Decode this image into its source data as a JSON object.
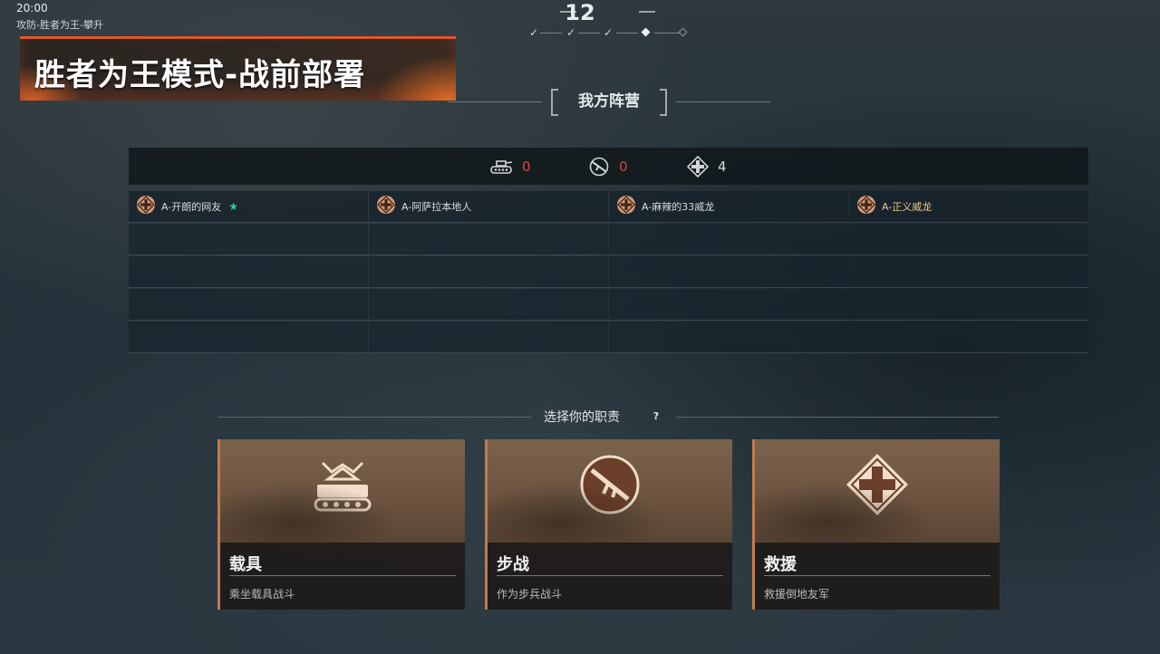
{
  "hud": {
    "clock": "20:00",
    "mode_subtitle": "攻防-胜者为王-攀升",
    "banner_title": "胜者为王模式-战前部署",
    "round_number": "12",
    "accent": "#e0572a"
  },
  "round_progress": {
    "steps": [
      {
        "state": "done",
        "glyph": "✓"
      },
      {
        "state": "done",
        "glyph": "✓"
      },
      {
        "state": "done",
        "glyph": "✓"
      },
      {
        "state": "current"
      },
      {
        "state": "upcoming"
      }
    ]
  },
  "team": {
    "label": "我方阵营",
    "stats": [
      {
        "icon": "tank-icon",
        "value": "0",
        "color": "#d5493b"
      },
      {
        "icon": "rifle-icon",
        "value": "0",
        "color": "#d5493b"
      },
      {
        "icon": "medic-cross-icon",
        "value": "4",
        "color": "#d8dcdc"
      }
    ],
    "players": [
      {
        "name": "A-开朗的网友",
        "role_icon": "medic-cross-icon",
        "badge": "medal-icon",
        "name_color": "#d7dbdb"
      },
      {
        "name": "A-阿萨拉本地人",
        "role_icon": "medic-cross-icon",
        "badge": "",
        "name_color": "#d7dbdb"
      },
      {
        "name": "A-麻辣的33威龙",
        "role_icon": "medic-cross-icon",
        "badge": "",
        "name_color": "#d7dbdb"
      },
      {
        "name": "A-正义威龙",
        "role_icon": "medic-cross-icon",
        "badge": "",
        "name_color": "#e6c98a"
      }
    ],
    "empty_rows": 4
  },
  "roles": {
    "title": "选择你的职责",
    "help": "?",
    "cards": [
      {
        "name": "载具",
        "description": "乘坐载具战斗",
        "icon": "tank-icon"
      },
      {
        "name": "步战",
        "description": "作为步兵战斗",
        "icon": "rifle-icon"
      },
      {
        "name": "救援",
        "description": "救援倒地友军",
        "icon": "medic-cross-icon"
      }
    ]
  }
}
